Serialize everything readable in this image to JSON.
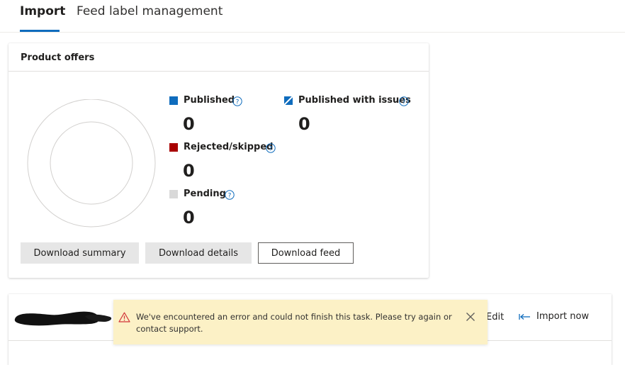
{
  "tabs": [
    {
      "label": "Import",
      "active": true
    },
    {
      "label": "Feed label management",
      "active": false
    }
  ],
  "product_offers": {
    "title": "Product offers",
    "legend": {
      "published": {
        "label": "Published",
        "count": "0",
        "color": "#0f6cbd"
      },
      "published_with_issues": {
        "label": "Published with issues",
        "count": "0",
        "color": "#0f6cbd"
      },
      "rejected": {
        "label": "Rejected/skipped",
        "count": "0",
        "color": "#a80000"
      },
      "pending": {
        "label": "Pending",
        "count": "0",
        "color": "#d9d9d9"
      }
    },
    "buttons": {
      "download_summary": "Download summary",
      "download_details": "Download details",
      "download_feed": "Download feed"
    }
  },
  "feed_panel": {
    "edit_label": "Edit",
    "import_now_label": "Import now"
  },
  "toast": {
    "message": "We've encountered an error and could not finish this task. Please try again or contact support.",
    "type": "warning"
  },
  "icons": {
    "info": "info-circle-icon",
    "warning": "warning-triangle-icon",
    "close": "close-icon",
    "import": "import-arrow-icon"
  }
}
